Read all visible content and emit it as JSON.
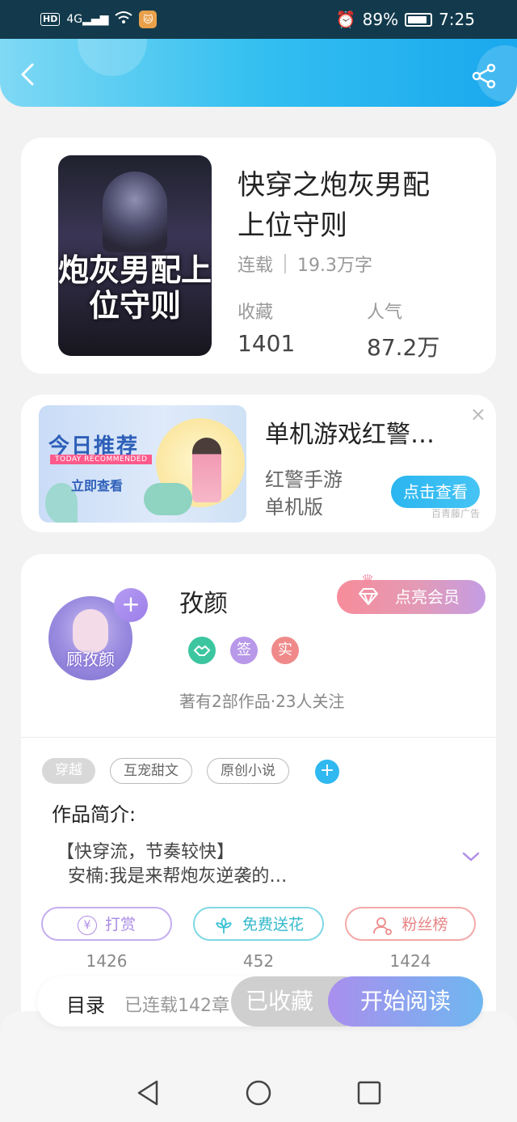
{
  "status_bar": {
    "hd": "HD",
    "network": "4G",
    "battery_percent": "89%",
    "battery_level": 0.89,
    "time": "7:25"
  },
  "book": {
    "title_line1": "快穿之炮灰男配",
    "title_line2": "上位守则",
    "cover_title": "炮灰男配上位守则",
    "status": "连载",
    "word_count": "19.3万字",
    "favorites_label": "收藏",
    "favorites_value": "1401",
    "popularity_label": "人气",
    "popularity_value": "87.2万"
  },
  "ad": {
    "banner_title": "今日推荐",
    "banner_subtitle": "TODAY RECOMMENDED",
    "banner_cta": "立即查看",
    "headline": "单机游戏红警…",
    "desc_line1": "红警手游",
    "desc_line2": "单机版",
    "button": "点击查看",
    "source": "百青藤广告",
    "close": "×"
  },
  "author": {
    "name": "孜颜",
    "avatar_text": "顾孜颜",
    "vip_button": "点亮会员",
    "badge_sign": "签",
    "badge_real": "实",
    "meta": "著有2部作品·23人关注"
  },
  "tags": [
    "穿越",
    "互宠甜文",
    "原创小说"
  ],
  "intro": {
    "heading": "作品简介:",
    "line1": "【快穿流，节奏较快】",
    "line2": "安楠:我是来帮炮灰逆袭的…"
  },
  "actions": [
    {
      "label": "打赏",
      "count": "1426",
      "color": "#b08de6"
    },
    {
      "label": "免费送花",
      "count": "452",
      "color": "#3ec3d6"
    },
    {
      "label": "粉丝榜",
      "count": "1424",
      "color": "#ef8a8a"
    }
  ],
  "bottom_bar": {
    "toc": "目录",
    "toc_status": "已连载142章",
    "collected": "已收藏",
    "start_reading": "开始阅读"
  },
  "colors": {
    "accent_blue": "#33bff0",
    "accent_purple": "#a98fee"
  }
}
